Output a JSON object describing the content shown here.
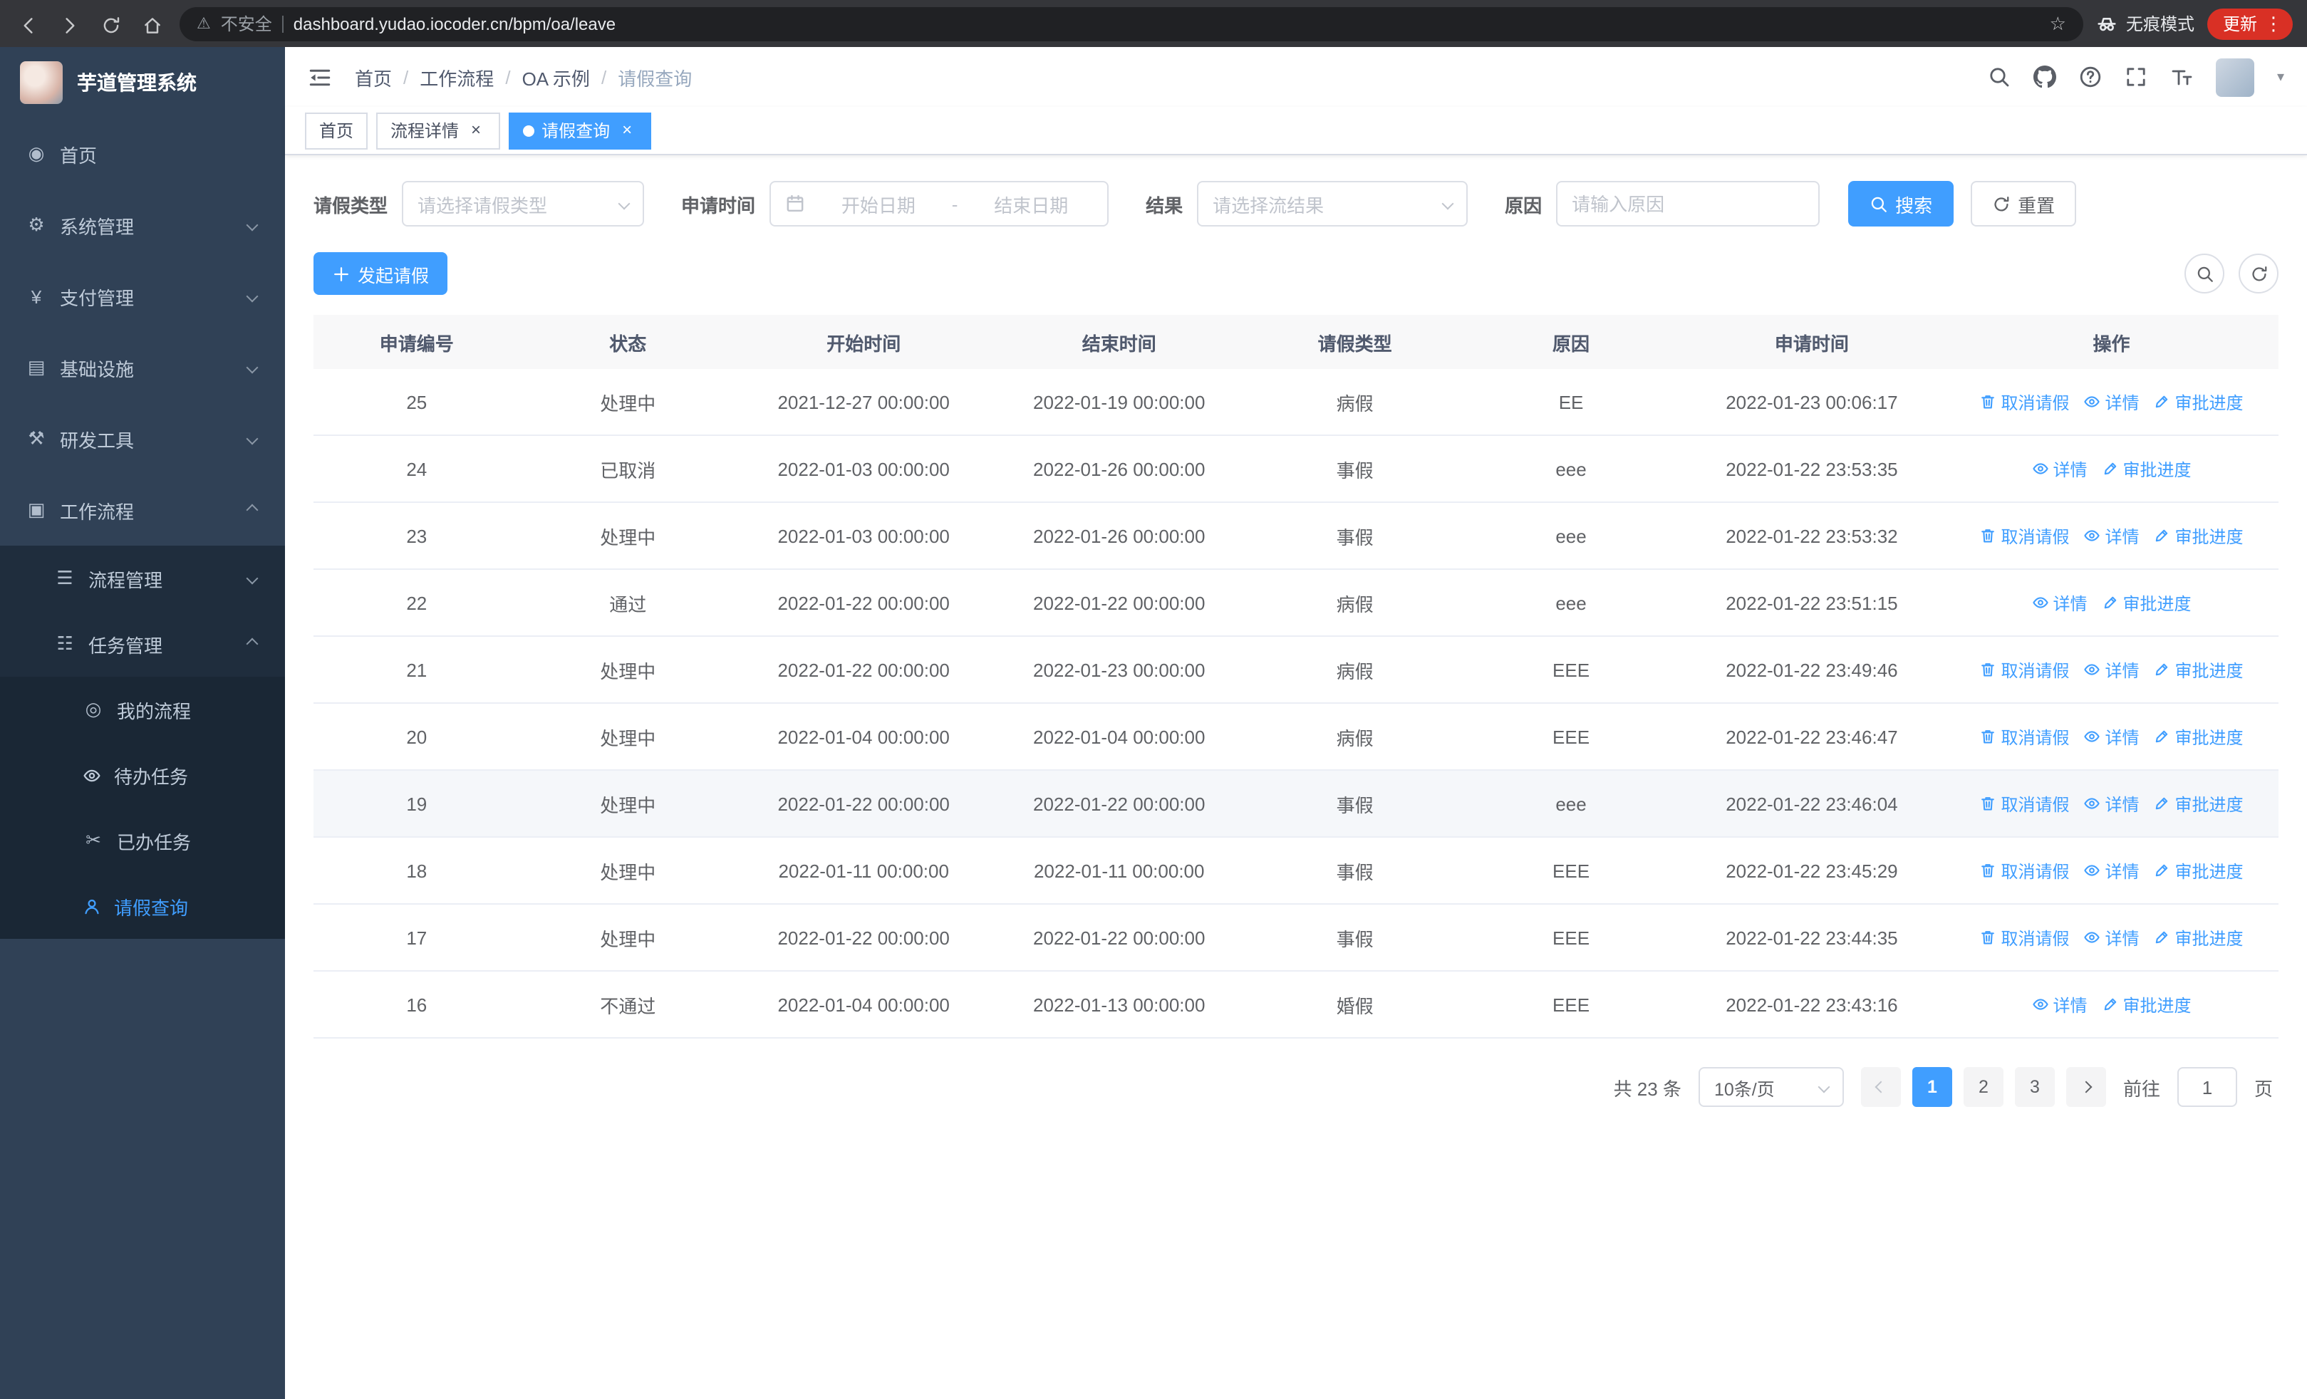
{
  "colors": {
    "primary": "#409eff",
    "sidebar_bg": "#304156",
    "submenu_bg": "#1f2d3d",
    "link": "#409eff",
    "update_pill": "#d93025",
    "table_border": "#ebeef5"
  },
  "browser": {
    "security_label": "不安全",
    "url": "dashboard.yudao.iocoder.cn/bpm/oa/leave",
    "incognito_label": "无痕模式",
    "update_label": "更新"
  },
  "sidebar": {
    "app_title": "芋道管理系统",
    "menu": [
      {
        "name": "home",
        "label": "首页",
        "icon": "dashboard-icon",
        "type": "item",
        "level": 1
      },
      {
        "name": "system-mgmt",
        "label": "系统管理",
        "icon": "gear-icon",
        "type": "submenu",
        "state": "collapsed",
        "level": 1
      },
      {
        "name": "payment-mgmt",
        "label": "支付管理",
        "icon": "yen-icon",
        "type": "submenu",
        "state": "collapsed",
        "level": 1
      },
      {
        "name": "infrastructure",
        "label": "基础设施",
        "icon": "infrastructure-icon",
        "type": "submenu",
        "state": "collapsed",
        "level": 1
      },
      {
        "name": "dev-tools",
        "label": "研发工具",
        "icon": "tools-icon",
        "type": "submenu",
        "state": "collapsed",
        "level": 1
      },
      {
        "name": "workflow",
        "label": "工作流程",
        "icon": "workflow-icon",
        "type": "submenu",
        "state": "expanded",
        "level": 1,
        "children": [
          {
            "name": "process-mgmt",
            "label": "流程管理",
            "icon": "process-icon",
            "type": "submenu",
            "state": "collapsed",
            "level": 2
          },
          {
            "name": "task-mgmt",
            "label": "任务管理",
            "icon": "task-icon",
            "type": "submenu",
            "state": "expanded",
            "level": 2,
            "children": [
              {
                "name": "my-process",
                "label": "我的流程",
                "icon": "my-process-icon",
                "type": "item",
                "level": 3
              },
              {
                "name": "todo-tasks",
                "label": "待办任务",
                "icon": "eye-icon",
                "type": "item",
                "level": 3
              },
              {
                "name": "done-tasks",
                "label": "已办任务",
                "icon": "done-task-icon",
                "type": "item",
                "level": 3
              },
              {
                "name": "leave-query",
                "label": "请假查询",
                "icon": "person-icon",
                "type": "item",
                "level": 3,
                "active": true
              }
            ]
          }
        ]
      }
    ]
  },
  "header": {
    "breadcrumb": [
      "首页",
      "工作流程",
      "OA 示例",
      "请假查询"
    ]
  },
  "tabs": [
    {
      "name": "home",
      "label": "首页",
      "closable": false,
      "active": false
    },
    {
      "name": "process-detail",
      "label": "流程详情",
      "closable": true,
      "active": false
    },
    {
      "name": "leave-query",
      "label": "请假查询",
      "closable": true,
      "active": true
    }
  ],
  "filters": {
    "leave_type_label": "请假类型",
    "leave_type_placeholder": "请选择请假类型",
    "apply_time_label": "申请时间",
    "start_date_placeholder": "开始日期",
    "date_separator": "-",
    "end_date_placeholder": "结束日期",
    "result_label": "结果",
    "result_placeholder": "请选择流结果",
    "reason_label": "原因",
    "reason_placeholder": "请输入原因",
    "search_label": "搜索",
    "reset_label": "重置"
  },
  "toolbar": {
    "create_label": "发起请假"
  },
  "table": {
    "columns": [
      "申请编号",
      "状态",
      "开始时间",
      "结束时间",
      "请假类型",
      "原因",
      "申请时间",
      "操作"
    ],
    "actions": {
      "cancel": "取消请假",
      "detail": "详情",
      "progress": "审批进度"
    },
    "rows": [
      {
        "id": "25",
        "status": "处理中",
        "start_time": "2021-12-27 00:00:00",
        "end_time": "2022-01-19 00:00:00",
        "leave_type": "病假",
        "reason": "EE",
        "apply_time": "2022-01-23 00:06:17",
        "can_cancel": true
      },
      {
        "id": "24",
        "status": "已取消",
        "start_time": "2022-01-03 00:00:00",
        "end_time": "2022-01-26 00:00:00",
        "leave_type": "事假",
        "reason": "eee",
        "apply_time": "2022-01-22 23:53:35",
        "can_cancel": false
      },
      {
        "id": "23",
        "status": "处理中",
        "start_time": "2022-01-03 00:00:00",
        "end_time": "2022-01-26 00:00:00",
        "leave_type": "事假",
        "reason": "eee",
        "apply_time": "2022-01-22 23:53:32",
        "can_cancel": true
      },
      {
        "id": "22",
        "status": "通过",
        "start_time": "2022-01-22 00:00:00",
        "end_time": "2022-01-22 00:00:00",
        "leave_type": "病假",
        "reason": "eee",
        "apply_time": "2022-01-22 23:51:15",
        "can_cancel": false
      },
      {
        "id": "21",
        "status": "处理中",
        "start_time": "2022-01-22 00:00:00",
        "end_time": "2022-01-23 00:00:00",
        "leave_type": "病假",
        "reason": "EEE",
        "apply_time": "2022-01-22 23:49:46",
        "can_cancel": true
      },
      {
        "id": "20",
        "status": "处理中",
        "start_time": "2022-01-04 00:00:00",
        "end_time": "2022-01-04 00:00:00",
        "leave_type": "病假",
        "reason": "EEE",
        "apply_time": "2022-01-22 23:46:47",
        "can_cancel": true
      },
      {
        "id": "19",
        "status": "处理中",
        "start_time": "2022-01-22 00:00:00",
        "end_time": "2022-01-22 00:00:00",
        "leave_type": "事假",
        "reason": "eee",
        "apply_time": "2022-01-22 23:46:04",
        "can_cancel": true,
        "highlight": true
      },
      {
        "id": "18",
        "status": "处理中",
        "start_time": "2022-01-11 00:00:00",
        "end_time": "2022-01-11 00:00:00",
        "leave_type": "事假",
        "reason": "EEE",
        "apply_time": "2022-01-22 23:45:29",
        "can_cancel": true
      },
      {
        "id": "17",
        "status": "处理中",
        "start_time": "2022-01-22 00:00:00",
        "end_time": "2022-01-22 00:00:00",
        "leave_type": "事假",
        "reason": "EEE",
        "apply_time": "2022-01-22 23:44:35",
        "can_cancel": true
      },
      {
        "id": "16",
        "status": "不通过",
        "start_time": "2022-01-04 00:00:00",
        "end_time": "2022-01-13 00:00:00",
        "leave_type": "婚假",
        "reason": "EEE",
        "apply_time": "2022-01-22 23:43:16",
        "can_cancel": false
      }
    ]
  },
  "pagination": {
    "total_text": "共 23 条",
    "page_size_text": "10条/页",
    "pages": [
      "1",
      "2",
      "3"
    ],
    "active_page": "1",
    "goto_prefix": "前往",
    "goto_value": "1",
    "goto_suffix": "页"
  }
}
